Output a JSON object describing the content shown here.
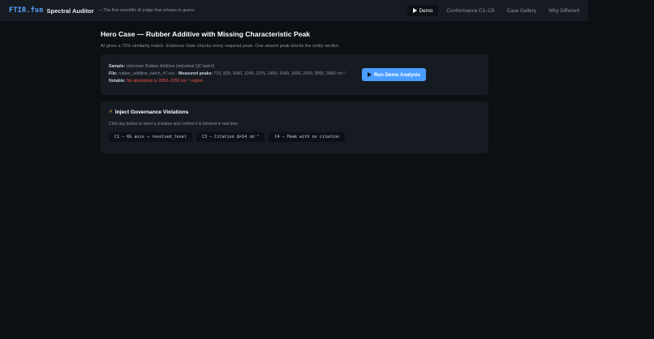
{
  "nav": {
    "brand": "FTIR.fun",
    "title": "Spectral Auditor",
    "tagline": "— The first scientific AI judge that refuses to guess",
    "demo_label": "Demo",
    "links": [
      "Conformance C1–C8",
      "Case Gallery",
      "Why Different"
    ]
  },
  "page": {
    "title": "Hero Case — Rubber Additive with Missing Characteristic Peak",
    "subtitle": "AI gives a 70% similarity match. Evidence Gate checks every required peak. One absent peak blocks the entity verdict."
  },
  "sample": {
    "sample_label": "Sample:",
    "sample_value": "Unknown Rubber Additive (industrial QC batch)",
    "file_label": "File:",
    "file_value": "rubber_additive_batch_47.csv",
    "separator": "·",
    "peaks_label": "Measured peaks:",
    "peaks_value": "710, 820, 1060, 1240, 1375, 1460, 1540, 1600, 2920, 3000, 3060 cm⁻¹",
    "notable_label": "Notable:",
    "notable_value": "No absorption in 2050–2250 cm⁻¹ region",
    "run_label": "Run Demo Analysis"
  },
  "governance": {
    "icon": "⚡",
    "title": "Inject Governance Violations",
    "hint": "Click any button to inject a violation and confirm it is blocked in real time.",
    "buttons": [
      "C1 — KG axis → resolved_level",
      "C3 — Citation Δ=14 cm⁻¹",
      "C4 — Peak with no citation"
    ]
  },
  "colors": {
    "background": "#0c0f14",
    "nav_bg": "#161b22",
    "accent": "#4a9eff",
    "brand": "#58a6ff",
    "warning": "#f85149"
  }
}
